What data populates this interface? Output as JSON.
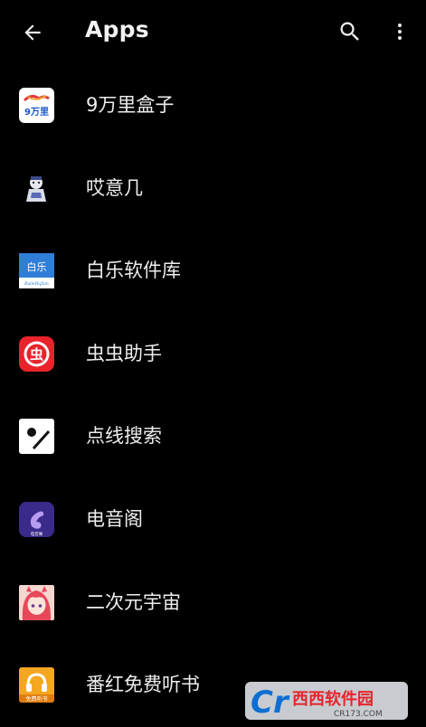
{
  "header": {
    "title": "Apps"
  },
  "apps": [
    {
      "label": "9万里盒子",
      "icon": "9wanli-box-icon",
      "icon_text": "9万里"
    },
    {
      "label": "哎意几",
      "icon": "aiyiji-icon",
      "icon_text": ""
    },
    {
      "label": "白乐软件库",
      "icon": "baile-library-icon",
      "icon_text": "白乐",
      "icon_subtext": "BaileRuJian"
    },
    {
      "label": "虫虫助手",
      "icon": "chongchong-helper-icon",
      "icon_text": "虫"
    },
    {
      "label": "点线搜索",
      "icon": "dianxian-search-icon",
      "icon_text": ""
    },
    {
      "label": "电音阁",
      "icon": "dianyinge-icon",
      "icon_text": "电音阁"
    },
    {
      "label": "二次元宇宙",
      "icon": "erciyuan-universe-icon",
      "icon_text": ""
    },
    {
      "label": "番红免费听书",
      "icon": "fanhong-audiobook-icon",
      "icon_text": "免费听书"
    }
  ],
  "watermark": {
    "brand": "西西软件园",
    "site": "CR173.COM"
  },
  "colors": {
    "background": "#000000",
    "text": "#eeeeee"
  }
}
